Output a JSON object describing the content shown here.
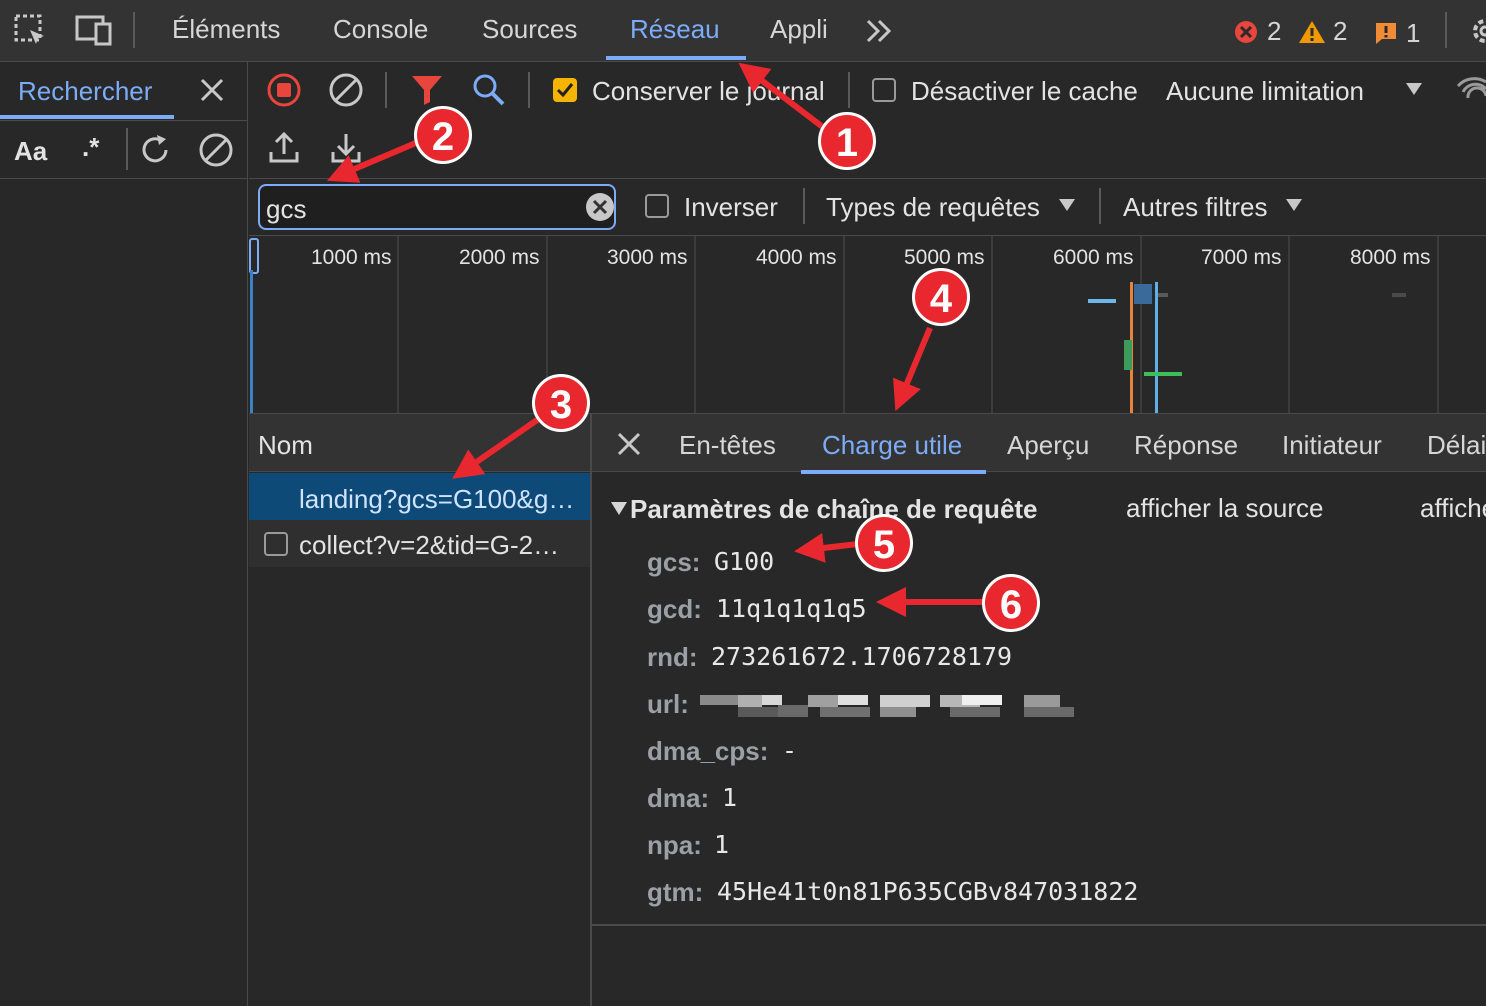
{
  "top_tabs": [
    "Éléments",
    "Console",
    "Sources",
    "Réseau",
    "Appli"
  ],
  "more_tabs_icon": "chevron-double-right-icon",
  "counts": {
    "errors": "2",
    "warnings": "2",
    "issues": "1"
  },
  "search_panel": {
    "title": "Rechercher",
    "match_case": "Aa",
    "regex": ".*"
  },
  "toolbar": {
    "preserve_log": "Conserver le journal",
    "disable_cache": "Désactiver le cache",
    "throttling": "Aucune limitation"
  },
  "filter": {
    "value": "gcs",
    "invert": "Inverser",
    "request_types": "Types de requêtes",
    "other_filters": "Autres filtres"
  },
  "timeline": {
    "ticks": [
      "1000 ms",
      "2000 ms",
      "3000 ms",
      "4000 ms",
      "5000 ms",
      "6000 ms",
      "7000 ms",
      "8000 ms"
    ]
  },
  "requests": {
    "header": "Nom",
    "rows": [
      "landing?gcs=G100&g…",
      "collect?v=2&tid=G-2…"
    ]
  },
  "detail_tabs": [
    "En-têtes",
    "Charge utile",
    "Aperçu",
    "Réponse",
    "Initiateur",
    "Délai"
  ],
  "payload": {
    "section_title": "Paramètres de chaîne de requête",
    "view_source": "afficher la source",
    "view_decoded": "afficher",
    "params": [
      {
        "key": "gcs:",
        "value": "G100"
      },
      {
        "key": "gcd:",
        "value": "11q1q1q1q5"
      },
      {
        "key": "rnd:",
        "value": "273261672.1706728179"
      },
      {
        "key": "url:",
        "value": ""
      },
      {
        "key": "dma_cps:",
        "value": "-"
      },
      {
        "key": "dma:",
        "value": "1"
      },
      {
        "key": "npa:",
        "value": "1"
      },
      {
        "key": "gtm:",
        "value": "45He41t0n81P635CGBv847031822"
      }
    ]
  },
  "annotations": [
    "1",
    "2",
    "3",
    "4",
    "5",
    "6"
  ],
  "colors": {
    "accent": "#7cacf8",
    "record": "#e8453c",
    "annotation": "#e8282e",
    "checkbox": "#f4b400"
  }
}
